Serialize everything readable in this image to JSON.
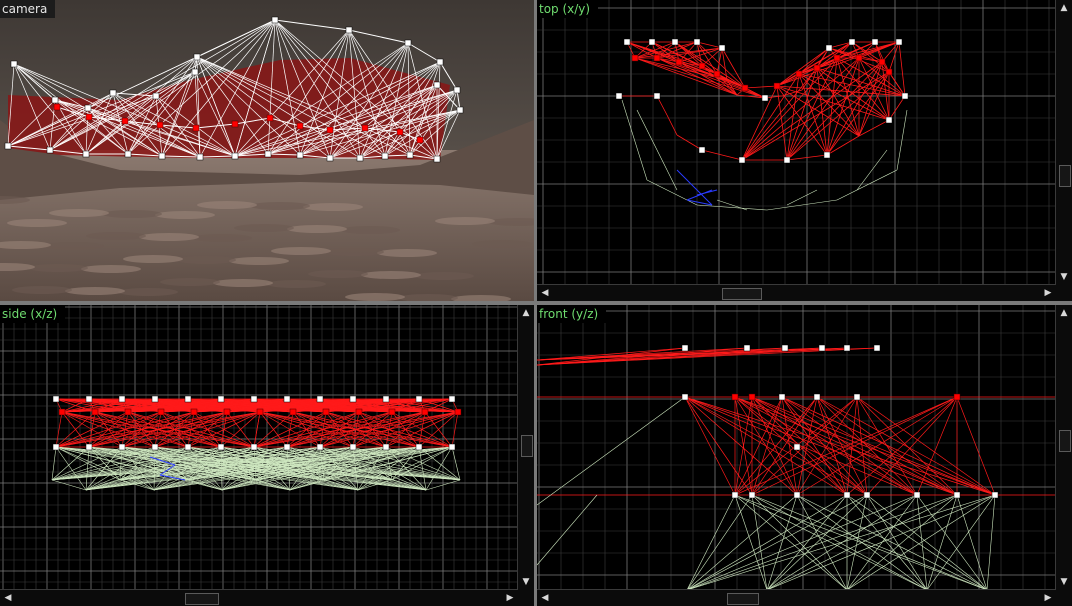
{
  "viewports": {
    "camera": {
      "label": "camera"
    },
    "top": {
      "label": "top (x/y)"
    },
    "side": {
      "label": "side (x/z)"
    },
    "front": {
      "label": "front (y/z)"
    }
  },
  "scrollbar_arrows": {
    "up": "▲",
    "down": "▼",
    "left": "◀",
    "right": "▶"
  },
  "colors": {
    "grid": "#3c3c3c",
    "grid_major": "#7a7a7a",
    "selected_mesh": "#ff1a1a",
    "vertex": "#ffffff",
    "selected_vertex": "#ff0000",
    "mesh_other": "#cfe8c0",
    "mesh_blue": "#2a3cff",
    "camera_wall": "#8a1515",
    "label_text": "#6fdc6f"
  }
}
